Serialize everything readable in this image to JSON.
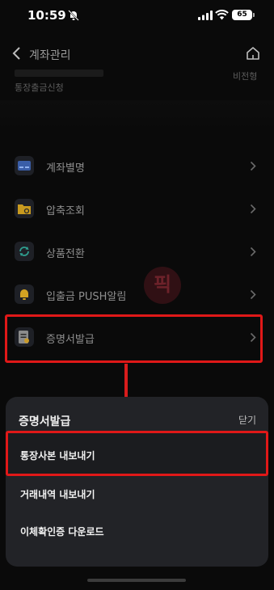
{
  "status_bar": {
    "time": "10:59",
    "battery": "65"
  },
  "header": {
    "title": "계좌관리"
  },
  "account": {
    "subtitle": "통장출금신청",
    "right_text": "비전형"
  },
  "menu": {
    "items": [
      {
        "label": "계좌별명",
        "icon": "card-icon",
        "color": "#3a5ea8"
      },
      {
        "label": "압축조회",
        "icon": "folder-search-icon",
        "color": "#c89a1f"
      },
      {
        "label": "상품전환",
        "icon": "refresh-icon",
        "color": "#2f9e8f"
      },
      {
        "label": "입출금 PUSH알림",
        "icon": "bell-icon",
        "color": "#d3a322"
      },
      {
        "label": "증명서발급",
        "icon": "document-icon",
        "color": "#8b8b8b"
      }
    ]
  },
  "sheet": {
    "title": "증명서발급",
    "close_label": "닫기",
    "options": [
      {
        "label": "통장사본 내보내기"
      },
      {
        "label": "거래내역 내보내기"
      },
      {
        "label": "이체확인증 다운로드"
      }
    ]
  },
  "annotation": {
    "color": "#e01818"
  }
}
